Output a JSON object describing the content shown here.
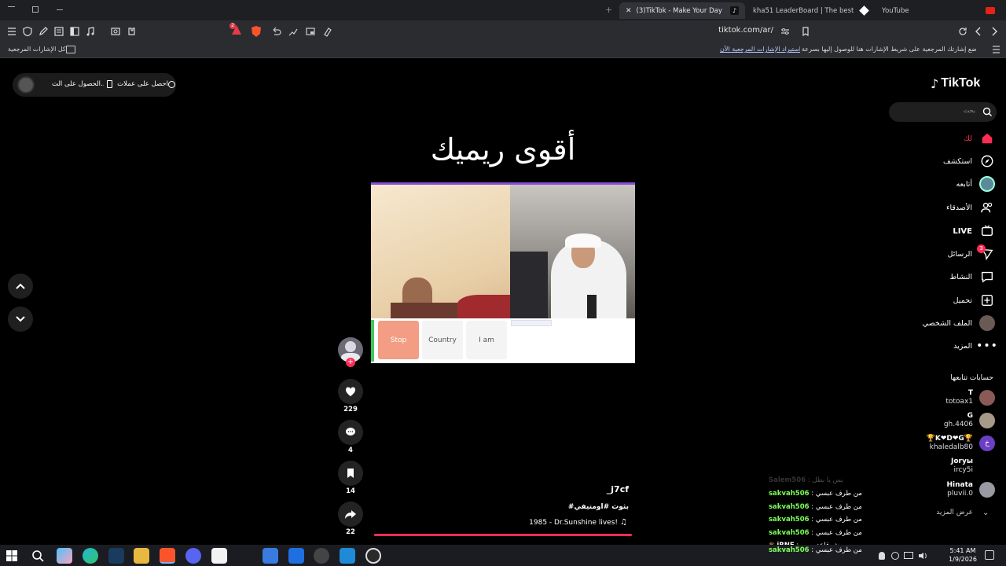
{
  "browser": {
    "tabs": [
      {
        "label": "(3)TikTok - Make Your Day",
        "active": true
      },
      {
        "label": "kha51 LeaderBoard | The best ChatLi"
      },
      {
        "label": "YouTube"
      }
    ],
    "url": "tiktok.com/ar/",
    "bookmarks_folder": "كل الإشارات المرجعية",
    "bookmarks_hint": "ضع إشارتك المرجعية على شريط الإشارات هنا للوصول إليها بسرعة.",
    "bookmarks_link": "استيراد الإشارات المرجعية الآن..."
  },
  "tiktok": {
    "logo": "TikTok",
    "search_placeholder": "بحث",
    "top_actions": {
      "coins": "احصل على عملات",
      "app": "الحصول على الت..."
    },
    "nav": [
      {
        "label": "لك",
        "icon": "home-icon",
        "active": true
      },
      {
        "label": "استكشف",
        "icon": "compass-icon"
      },
      {
        "label": "أتابعه",
        "icon": "following-avatar-icon"
      },
      {
        "label": "الأصدقاء",
        "icon": "friends-icon"
      },
      {
        "label": "LIVE",
        "icon": "live-icon"
      },
      {
        "label": "الرسائل",
        "icon": "messages-icon",
        "badge": "3"
      },
      {
        "label": "النشاط",
        "icon": "activity-icon"
      },
      {
        "label": "تحميل",
        "icon": "upload-icon"
      },
      {
        "label": "الملف الشخصي",
        "icon": "profile-avatar-icon"
      },
      {
        "label": "المزيد",
        "icon": "more-icon"
      }
    ],
    "following_title": "حسابات تتابعها",
    "following": [
      {
        "name": "T",
        "handle": "totoax1"
      },
      {
        "name": "G",
        "handle": "gh.4406"
      },
      {
        "name": "🏆K❤D❤G🏆",
        "handle": "khaledalb80",
        "initial": "خ"
      },
      {
        "name": "Joryы",
        "handle": "ircy5i"
      },
      {
        "name": "Hinata",
        "handle": "pluvii.0"
      }
    ],
    "see_more": "عرض المزيد"
  },
  "video": {
    "title": "أقوى ريميك",
    "buttons": [
      "Stop",
      "Country",
      "I am"
    ],
    "author": "_j7cf",
    "hashtags": "#بثوث #اومتيفي",
    "music": "1985 - Dr.Sunshine lives!",
    "actions": {
      "likes": "229",
      "comments": "4",
      "saves": "14",
      "shares": "22"
    }
  },
  "chat": [
    {
      "user": "Salem506",
      "msg": "يس يا بطل",
      "faded": true
    },
    {
      "user": "sakvah506",
      "msg": "من طرف عبسي"
    },
    {
      "user": "sakvah506",
      "msg": "من طرف عبسي"
    },
    {
      "user": "sakvah506",
      "msg": "من طرف عبسي"
    },
    {
      "user": "sakvah506",
      "msg": "من طرف عبسي"
    },
    {
      "user": "iRNE",
      "msg": "وش قاعد يصير",
      "white": true
    },
    {
      "user": "sakvah506",
      "msg": "من طرف عبسي"
    }
  ],
  "taskbar": {
    "time": "5:41 AM",
    "date": "1/9/2026"
  },
  "colors": {
    "tiktok_red": "#fe2c55",
    "chat_green": "#7dff5a",
    "bg": "#000000"
  }
}
